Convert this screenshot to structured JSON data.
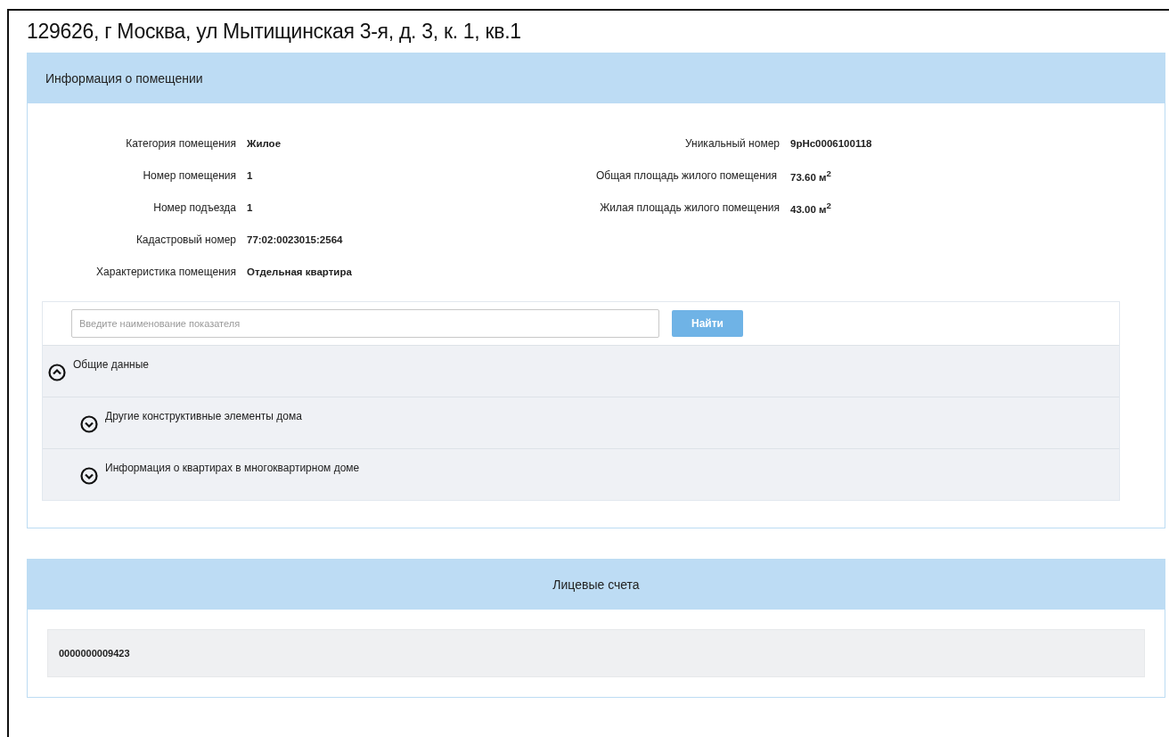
{
  "title": "129626, г Москва, ул Мытищинская 3-я, д. 3, к. 1, кв.1",
  "room_panel": {
    "header": "Информация о помещении",
    "left_fields": [
      {
        "label": "Категория помещения",
        "value": "Жилое"
      },
      {
        "label": "Номер помещения",
        "value": "1"
      },
      {
        "label": "Номер подъезда",
        "value": "1"
      },
      {
        "label": "Кадастровый номер",
        "value": "77:02:0023015:2564"
      },
      {
        "label": "Характеристика помещения",
        "value": "Отдельная квартира"
      }
    ],
    "right_fields": [
      {
        "label": "Уникальный номер",
        "value": "9рНс0006100118"
      },
      {
        "label": "Общая площадь жилого помещения",
        "value": "73.60 м$^{2}$"
      },
      {
        "label": "Жилая площадь жилого помещения",
        "value": "43.00 м$^{2}$"
      }
    ],
    "search": {
      "placeholder": "Введите наименование показателя",
      "button": "Найти"
    },
    "tree": [
      {
        "label": "Общие данные",
        "expanded": true,
        "children": [
          {
            "label": "Другие конструктивные элементы дома",
            "expanded": false
          },
          {
            "label": "Информация о квартирах в многоквартирном доме",
            "expanded": false
          }
        ]
      }
    ]
  },
  "accounts_panel": {
    "header": "Лицевые счета",
    "accounts": [
      "0000000009423"
    ]
  }
}
